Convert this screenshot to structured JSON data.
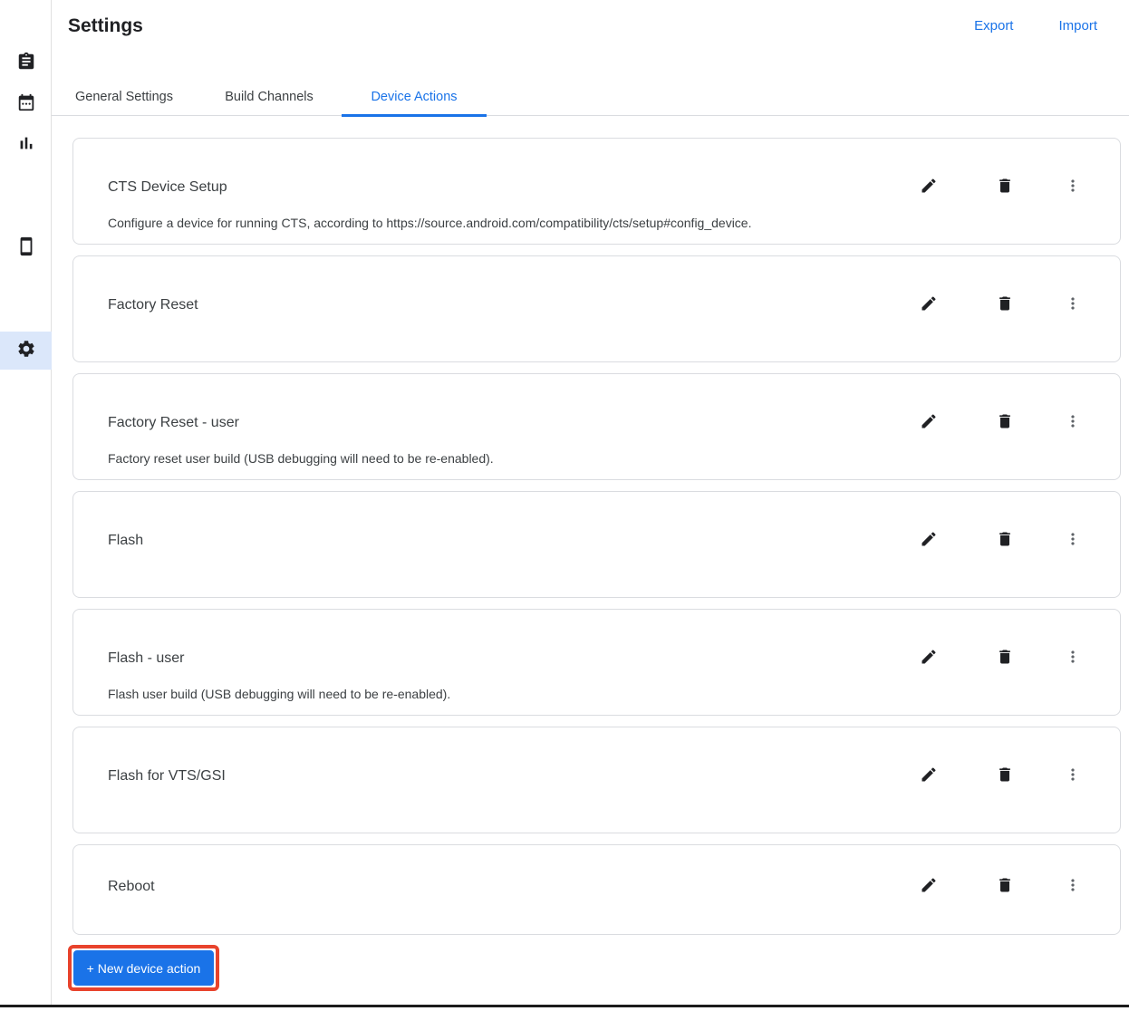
{
  "app": {
    "title": "Settings"
  },
  "header": {
    "export_label": "Export",
    "import_label": "Import"
  },
  "sidebar": {
    "items": [
      {
        "icon": "tasks-clipboard-icon",
        "selected": false
      },
      {
        "icon": "calendar-icon",
        "selected": false
      },
      {
        "icon": "bar-chart-icon",
        "selected": false
      },
      {
        "icon": "smartphone-icon",
        "selected": false
      },
      {
        "icon": "settings-gear-icon",
        "selected": true
      }
    ]
  },
  "tabs": [
    {
      "label": "General Settings",
      "active": false
    },
    {
      "label": "Build Channels",
      "active": false
    },
    {
      "label": "Device Actions",
      "active": true
    }
  ],
  "device_actions": [
    {
      "title": "CTS Device Setup",
      "description": "Configure a device for running CTS, according to https://source.android.com/compatibility/cts/setup#config_device."
    },
    {
      "title": "Factory Reset",
      "description": ""
    },
    {
      "title": "Factory Reset - user",
      "description": "Factory reset user build (USB debugging will need to be re-enabled)."
    },
    {
      "title": "Flash",
      "description": ""
    },
    {
      "title": "Flash - user",
      "description": "Flash user build (USB debugging will need to be re-enabled)."
    },
    {
      "title": "Flash for VTS/GSI",
      "description": ""
    },
    {
      "title": "Reboot",
      "description": ""
    }
  ],
  "row_actions": {
    "edit": "edit",
    "delete": "delete",
    "more": "more options"
  },
  "new_action_button": {
    "label": "+ New device action",
    "highlighted": true
  },
  "colors": {
    "accent_blue": "#1a73e8",
    "highlight_red": "#e8432c",
    "card_border": "#dadce0",
    "selected_item_bg": "#dbe7fa"
  }
}
